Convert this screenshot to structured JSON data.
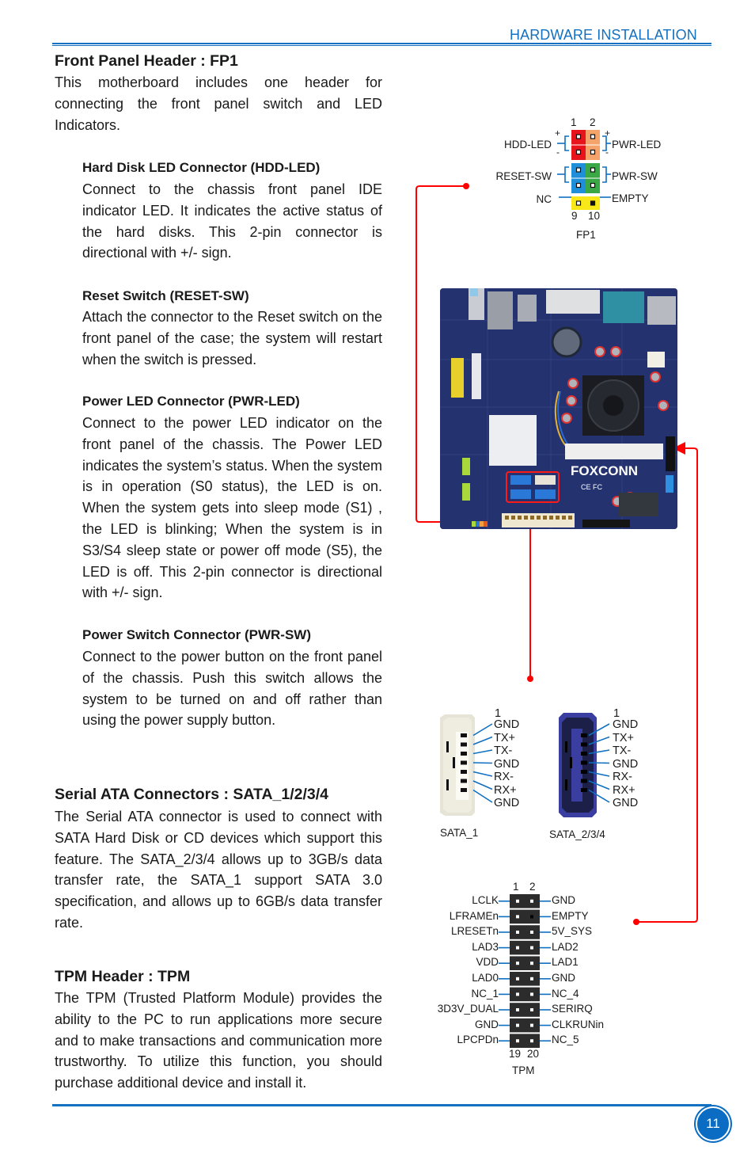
{
  "header": {
    "section_title": "HARDWARE INSTALLATION"
  },
  "footer": {
    "page_number": "11"
  },
  "colors": {
    "accent_blue": "#1470c0",
    "pointer_red": "#ff0000"
  },
  "front_panel": {
    "title": "Front Panel Header : FP1",
    "intro": "This motherboard includes one header for connecting the front panel switch and LED Indicators.",
    "subsections": [
      {
        "title": "Hard Disk LED Connector (HDD-LED)",
        "body": "Connect to the chassis front panel IDE indicator LED. It indicates the active status of the hard disks. This 2-pin connector is directional with +/- sign."
      },
      {
        "title": "Reset Switch (RESET-SW)",
        "body": "Attach the connector to the Reset switch on the front panel of the case; the system will restart when the switch is pressed."
      },
      {
        "title": "Power LED Connector (PWR-LED)",
        "body": "Connect to the power LED indicator on the front panel of the chassis. The Power LED indicates the system’s status. When the system is in operation (S0 status), the LED is on. When the system gets into sleep mode (S1) , the LED is blinking; When the system is in S3/S4 sleep state or power off mode (S5), the LED is off. This 2-pin connector is directional with +/- sign."
      },
      {
        "title": "Power Switch Connector (PWR-SW)",
        "body": "Connect to the power button on the front panel of the chassis. Push this switch allows the system to be turned on and off rather than using the power supply button."
      }
    ]
  },
  "sata": {
    "title": "Serial ATA Connectors : SATA_1/2/3/4",
    "body": "The Serial ATA connector is used to connect with SATA Hard Disk or CD devices which support this feature. The SATA_2/3/4 allows up to 3GB/s data transfer rate, the SATA_1 support SATA 3.0 specification, and allows up to 6GB/s data transfer rate."
  },
  "tpm": {
    "title": "TPM Header : TPM",
    "body": "The TPM (Trusted Platform Module) provides the ability to the PC to run applications more secure and to make transactions and communication more trustworthy. To utilize this function, you should purchase additional device and install it."
  },
  "fp1_diagram": {
    "name": "FP1",
    "top_pins": [
      "1",
      "2"
    ],
    "bottom_pins": [
      "9",
      "10"
    ],
    "left_labels": [
      "HDD-LED",
      "RESET-SW",
      "NC"
    ],
    "right_labels": [
      "PWR-LED",
      "PWR-SW",
      "EMPTY"
    ],
    "plus": "+",
    "minus": "-",
    "row_colors": [
      [
        "#e8141c",
        "#f4a36a"
      ],
      [
        "#e8141c",
        "#f4a36a"
      ],
      [
        "#1e8fd8",
        "#3aa845"
      ],
      [
        "#1e8fd8",
        "#3aa845"
      ],
      [
        "#f8e81a",
        "#f8e81a"
      ]
    ]
  },
  "sata_diagram": {
    "pin_number": "1",
    "pins": [
      "GND",
      "TX+",
      "TX-",
      "GND",
      "RX-",
      "RX+",
      "GND"
    ],
    "connectors": [
      {
        "name": "SATA_1"
      },
      {
        "name": "SATA_2/3/4"
      }
    ]
  },
  "tpm_diagram": {
    "name": "TPM",
    "top_pins": [
      "1",
      "2"
    ],
    "bottom_pins": [
      "19",
      "20"
    ],
    "left_labels": [
      "LCLK",
      "LFRAMEn",
      "LRESETn",
      "LAD3",
      "VDD",
      "LAD0",
      "NC_1",
      "3D3V_DUAL",
      "GND",
      "LPCPDn"
    ],
    "right_labels": [
      "GND",
      "EMPTY",
      "5V_SYS",
      "LAD2",
      "LAD1",
      "GND",
      "NC_4",
      "SERIRQ",
      "CLKRUNin",
      "NC_5"
    ]
  },
  "motherboard": {
    "brand_label": "FOXCONN",
    "cert_label": "CE FC"
  }
}
